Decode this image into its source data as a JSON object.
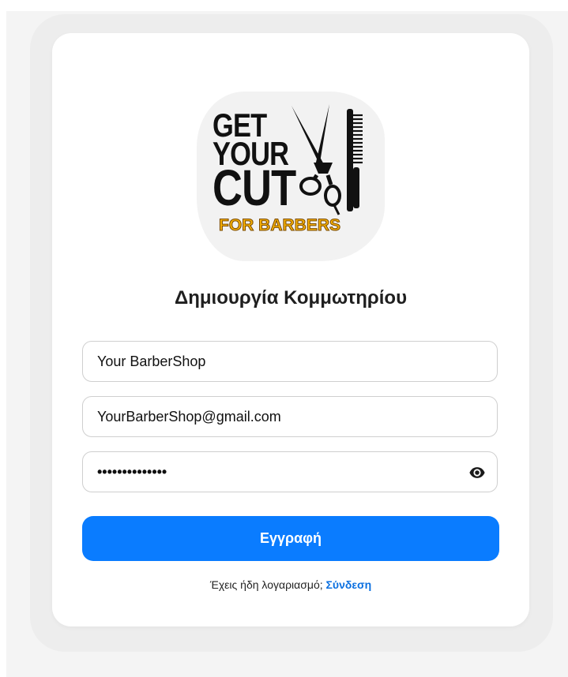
{
  "logo": {
    "line1": "GET",
    "line2": "YOUR",
    "line3": "CUT",
    "subtitle": "FOR BARBERS",
    "icon": "scissors-comb-icon"
  },
  "form": {
    "title": "Δημιουργία Κομμωτηρίου",
    "shop_name_value": "Your BarberShop",
    "email_value": "YourBarberShop@gmail.com",
    "password_masked": "••••••••••••••",
    "show_password_icon": "eye-icon",
    "submit_label": "Εγγραφή"
  },
  "footer": {
    "prompt": "Έχεις ήδη λογαριασμό;",
    "login_link": "Σύνδεση"
  },
  "colors": {
    "primary": "#0a7cff",
    "link": "#0a6fe0",
    "logo_accent": "#f5b000"
  }
}
